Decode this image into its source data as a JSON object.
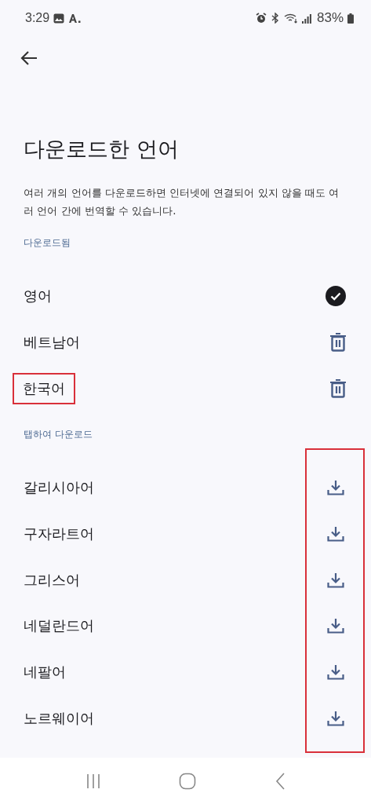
{
  "status_bar": {
    "time": "3:29",
    "battery": "83%"
  },
  "title": "다운로드한 언어",
  "description": "여러 개의 언어를 다운로드하면 인터넷에 연결되어 있지 않을 때도 여러 언어 간에 번역할 수 있습니다.",
  "sections": [
    {
      "heading": "다운로드됨",
      "items": [
        {
          "name": "영어",
          "kind": "default",
          "highlighted": false
        },
        {
          "name": "베트남어",
          "kind": "delete",
          "highlighted": false
        },
        {
          "name": "한국어",
          "kind": "delete",
          "highlighted": true
        }
      ]
    },
    {
      "heading": "탭하여 다운로드",
      "highlighted": true,
      "items": [
        {
          "name": "갈리시아어",
          "kind": "download",
          "highlighted": false
        },
        {
          "name": "구자라트어",
          "kind": "download",
          "highlighted": false
        },
        {
          "name": "그리스어",
          "kind": "download",
          "highlighted": false
        },
        {
          "name": "네덜란드어",
          "kind": "download",
          "highlighted": false
        },
        {
          "name": "네팔어",
          "kind": "download",
          "highlighted": false
        },
        {
          "name": "노르웨이어",
          "kind": "download",
          "highlighted": false
        }
      ]
    }
  ]
}
